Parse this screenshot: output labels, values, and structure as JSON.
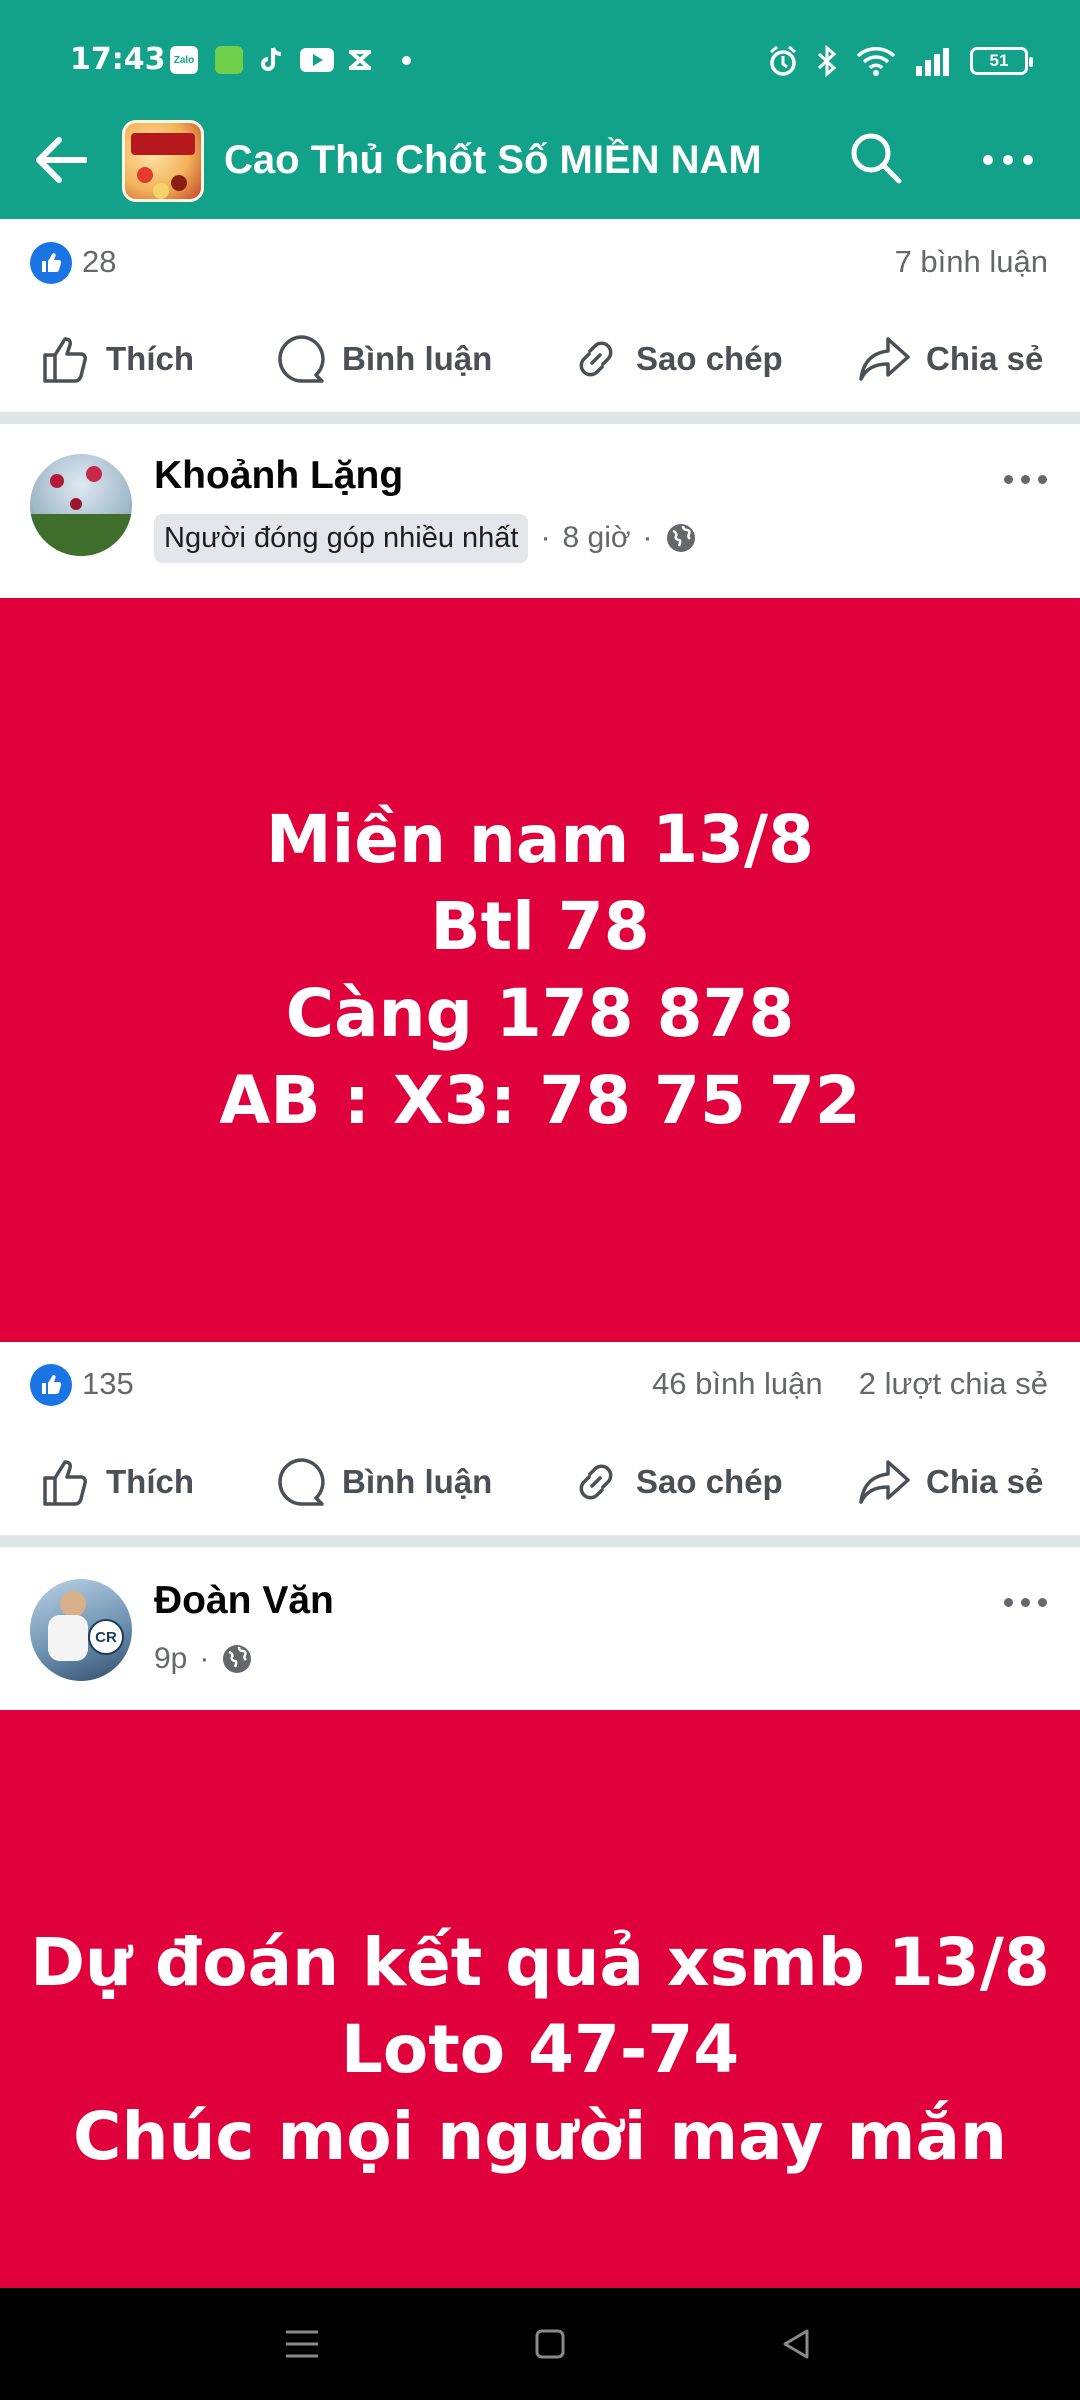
{
  "status_bar": {
    "time": "17:43",
    "notification_icons": [
      "zalo-icon",
      "app-icon",
      "tiktok-icon",
      "youtube-icon",
      "capcut-icon"
    ],
    "zalo_label": "Zalo",
    "battery": "51"
  },
  "app_bar": {
    "title": "Cao Thủ Chốt Số MIỀN NAM"
  },
  "post_top": {
    "likes": "28",
    "comments": "7 bình luận"
  },
  "actions": {
    "like": "Thích",
    "comment": "Bình luận",
    "copy": "Sao chép",
    "share": "Chia sẻ"
  },
  "post1": {
    "author": "Khoảnh Lặng",
    "badge": "Người đóng góp nhiều nhất",
    "time": "8 giờ",
    "image_lines": [
      "Miền nam 13/8",
      "Btl 78",
      "Càng 178 878",
      "AB : X3: 78 75 72"
    ],
    "likes": "135",
    "comments": "46 bình luận",
    "shares": "2 lượt chia sẻ"
  },
  "post2": {
    "author": "Đoàn Văn",
    "time": "9p",
    "avatar_text": "CR",
    "image_lines": [
      "Dự đoán kết quả xsmb 13/8",
      "Loto 47-74",
      "Chúc mọi người may mắn"
    ]
  },
  "colors": {
    "app_bar": "#12a189",
    "post_background": "#e0003c",
    "like_blue": "#1b74e4"
  }
}
